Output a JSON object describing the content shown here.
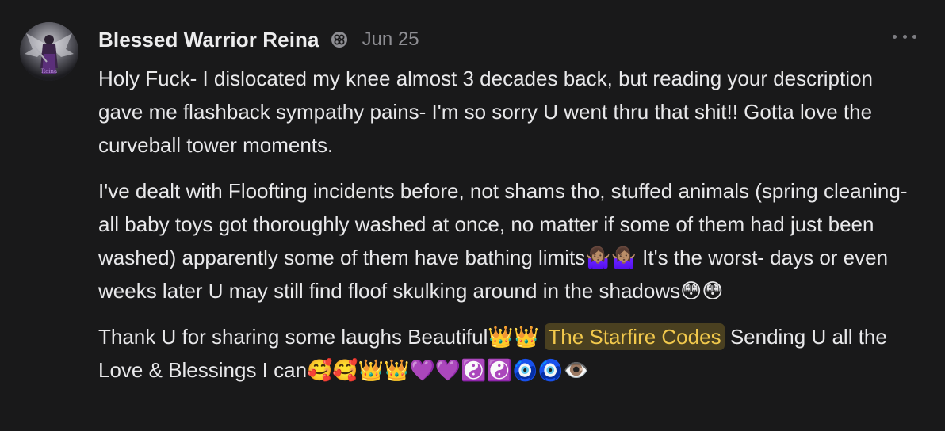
{
  "comment": {
    "author": "Blessed Warrior Reina",
    "date": "Jun 25",
    "badge_icon": "subscriber-badge-icon",
    "more_icon": "more-horizontal-icon",
    "paragraphs": {
      "p1": "Holy Fuck- I dislocated my knee almost 3 decades back, but reading your description gave me flashback sympathy pains- I'm so sorry U went thru that shit!! Gotta love the curveball tower moments.",
      "p2": "I've dealt with Floofting incidents before, not shams tho, stuffed animals (spring cleaning- all baby toys got thoroughly washed at once, no matter if some of them had just been washed) apparently some of them have bathing limits🤷🏽‍♀️🤷🏽‍♀️ It's the worst- days or even weeks later U may still find floof skulking around in the shadows😳😳",
      "p3_before": "Thank U for sharing some laughs Beautiful👑👑",
      "p3_link": "The Starfire Codes",
      "p3_after": "Sending U all the Love & Blessings I can🥰🥰👑👑💜💜☯️☯️🧿🧿👁️"
    }
  },
  "colors": {
    "background": "#19191a",
    "text": "#e8e8ea",
    "muted": "#8e8e93",
    "highlight_bg": "#4a4020",
    "highlight_text": "#f2c94c"
  }
}
